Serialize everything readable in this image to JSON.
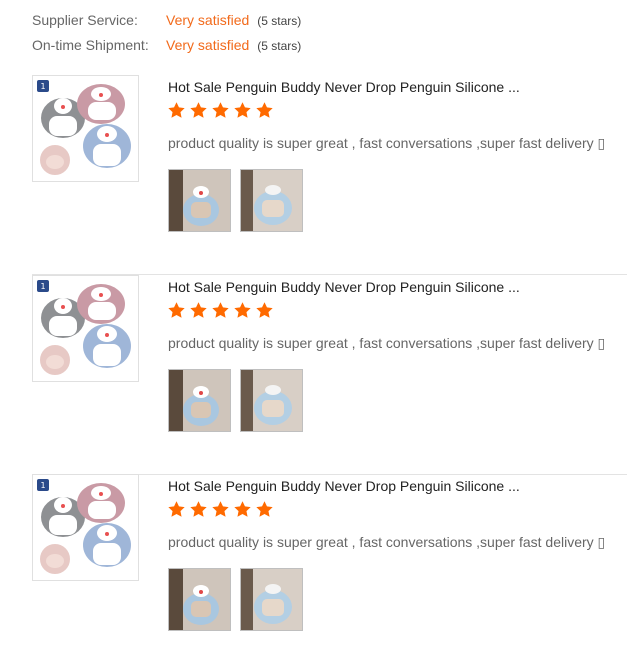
{
  "supplier_ratings": [
    {
      "label": "Supplier Service:",
      "value": "Very satisfied",
      "stars": "(5 stars)"
    },
    {
      "label": "On-time Shipment:",
      "value": "Very satisfied",
      "stars": "(5 stars)"
    }
  ],
  "reviews": [
    {
      "product_title": "Hot Sale Penguin Buddy Never Drop Penguin Silicone ...",
      "rating": 5,
      "comment": "product quality is super great , fast conversations ,super fast delivery ▯"
    },
    {
      "product_title": "Hot Sale Penguin Buddy Never Drop Penguin Silicone ...",
      "rating": 5,
      "comment": "product quality is super great , fast conversations ,super fast delivery ▯"
    },
    {
      "product_title": "Hot Sale Penguin Buddy Never Drop Penguin Silicone ...",
      "rating": 5,
      "comment": "product quality is super great , fast conversations ,super fast delivery ▯"
    }
  ],
  "colors": {
    "accent": "#f26a1b",
    "star": "#ff6a00"
  },
  "icons": {
    "star": "star-icon",
    "product_image": "penguin-teether-image",
    "review_photo": "review-photo-image"
  }
}
